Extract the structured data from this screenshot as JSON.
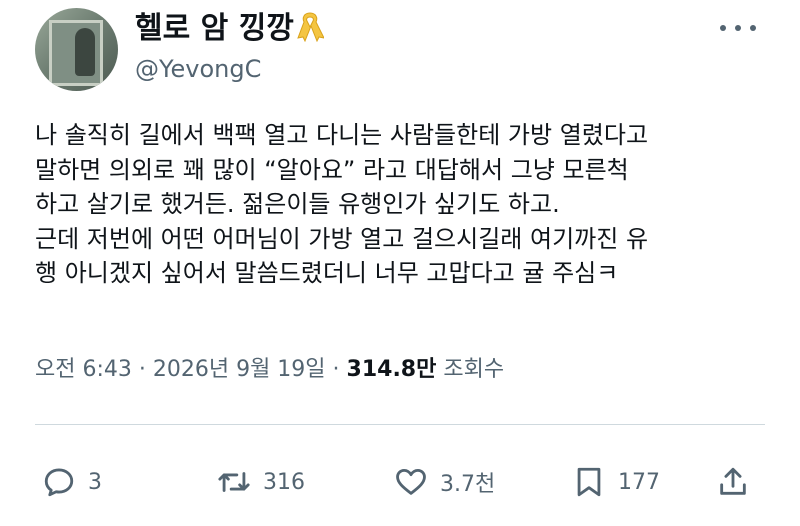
{
  "author": {
    "display_name": "헬로 암 낑깡",
    "handle": "@YevongC",
    "badge_icon": "yellow-ribbon-icon",
    "badge_color": "#f4c542"
  },
  "menu_icon": "more-options-icon",
  "post": {
    "lines": [
      "나 솔직히 길에서 백팩 열고 다니는 사람들한테 가방 열렸다고",
      "말하면 의외로 꽤 많이 “알아요” 라고 대답해서 그냥 모른척",
      "하고 살기로 했거든. 젊은이들 유행인가 싶기도 하고.",
      "근데 저번에 어떤 어머님이 가방 열고 걸으시길래 여기까진 유",
      "행 아니겠지 싶어서 말씀드렸더니 너무 고맙다고 귤 주심ㅋ"
    ]
  },
  "meta": {
    "timestamp": "오전 6:43 · 2026년 9월 19일 ·",
    "views": "314.8만",
    "views_label": "조회수"
  },
  "actions": {
    "reply": {
      "icon": "reply-icon",
      "count": "3"
    },
    "repost": {
      "icon": "repost-icon",
      "count": "316"
    },
    "like": {
      "icon": "heart-icon",
      "count": "3.7천"
    },
    "bookmark": {
      "icon": "bookmark-icon",
      "count": "177"
    },
    "share": {
      "icon": "share-icon"
    }
  },
  "colors": {
    "text": "#0f1419",
    "secondary_text": "#536471",
    "divider": "#cfd9de"
  }
}
